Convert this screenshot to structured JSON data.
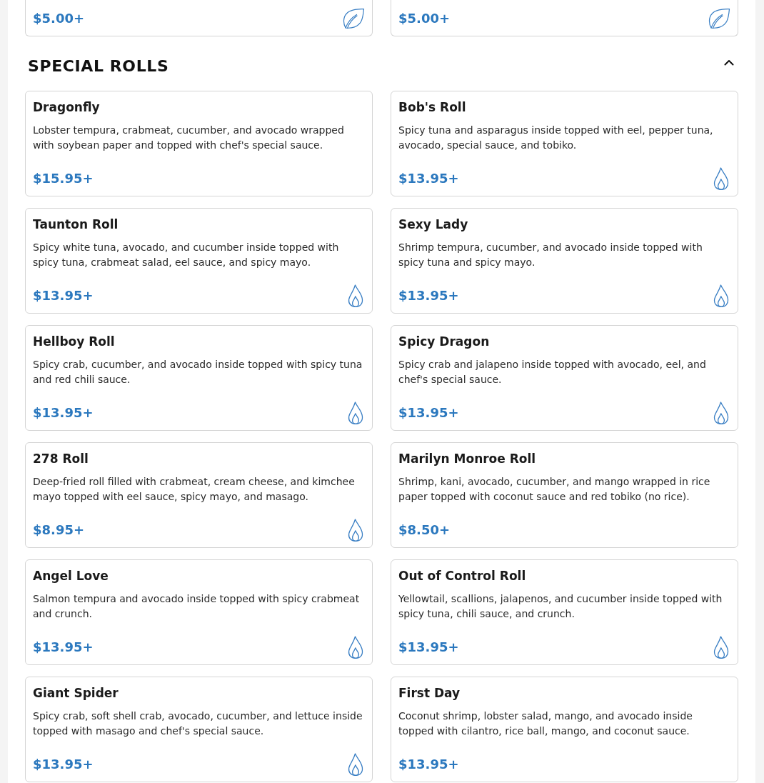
{
  "previous_section": {
    "items": [
      {
        "price": "$5.00+",
        "spicy": false,
        "vegetarian": true
      },
      {
        "price": "$5.00+",
        "spicy": false,
        "vegetarian": true
      }
    ]
  },
  "section": {
    "title": "SPECIAL ROLLS",
    "expanded": true,
    "items": [
      {
        "name": "Dragonfly",
        "description": "Lobster tempura, crabmeat, cucumber, and avocado wrapped with soybean paper and topped with chef's special sauce.",
        "price": "$15.95+",
        "spicy": false,
        "vegetarian": false
      },
      {
        "name": "Bob's Roll",
        "description": "Spicy tuna and asparagus inside topped with eel, pepper tuna, avocado, special sauce, and tobiko.",
        "price": "$13.95+",
        "spicy": true,
        "vegetarian": false
      },
      {
        "name": "Taunton Roll",
        "description": "Spicy white tuna, avocado, and cucumber inside topped with spicy tuna, crabmeat salad, eel sauce, and spicy mayo.",
        "price": "$13.95+",
        "spicy": true,
        "vegetarian": false
      },
      {
        "name": "Sexy Lady",
        "description": "Shrimp tempura, cucumber, and avocado inside topped with spicy tuna and spicy mayo.",
        "price": "$13.95+",
        "spicy": true,
        "vegetarian": false
      },
      {
        "name": "Hellboy Roll",
        "description": "Spicy crab, cucumber, and avocado inside topped with spicy tuna and red chili sauce.",
        "price": "$13.95+",
        "spicy": true,
        "vegetarian": false
      },
      {
        "name": "Spicy Dragon",
        "description": "Spicy crab and jalapeno inside topped with avocado, eel, and chef's special sauce.",
        "price": "$13.95+",
        "spicy": true,
        "vegetarian": false
      },
      {
        "name": "278 Roll",
        "description": "Deep-fried roll filled with crabmeat, cream cheese, and kimchee mayo topped with eel sauce, spicy mayo, and masago.",
        "price": "$8.95+",
        "spicy": true,
        "vegetarian": false
      },
      {
        "name": "Marilyn Monroe Roll",
        "description": "Shrimp, kani, avocado, cucumber, and mango wrapped in rice paper topped with coconut sauce and red tobiko (no rice).",
        "price": "$8.50+",
        "spicy": false,
        "vegetarian": false
      },
      {
        "name": "Angel Love",
        "description": "Salmon tempura and avocado inside topped with spicy crabmeat and crunch.",
        "price": "$13.95+",
        "spicy": true,
        "vegetarian": false
      },
      {
        "name": "Out of Control Roll",
        "description": "Yellowtail, scallions, jalapenos, and cucumber inside topped with spicy tuna, chili sauce, and crunch.",
        "price": "$13.95+",
        "spicy": true,
        "vegetarian": false
      },
      {
        "name": "Giant Spider",
        "description": "Spicy crab, soft shell crab, avocado, cucumber, and lettuce inside topped with masago and chef's special sauce.",
        "price": "$13.95+",
        "spicy": true,
        "vegetarian": false
      },
      {
        "name": "First Day",
        "description": "Coconut shrimp, lobster salad, mango, and avocado inside topped with cilantro, rice ball, mango, and coconut sauce.",
        "price": "$13.95+",
        "spicy": false,
        "vegetarian": false
      }
    ]
  }
}
